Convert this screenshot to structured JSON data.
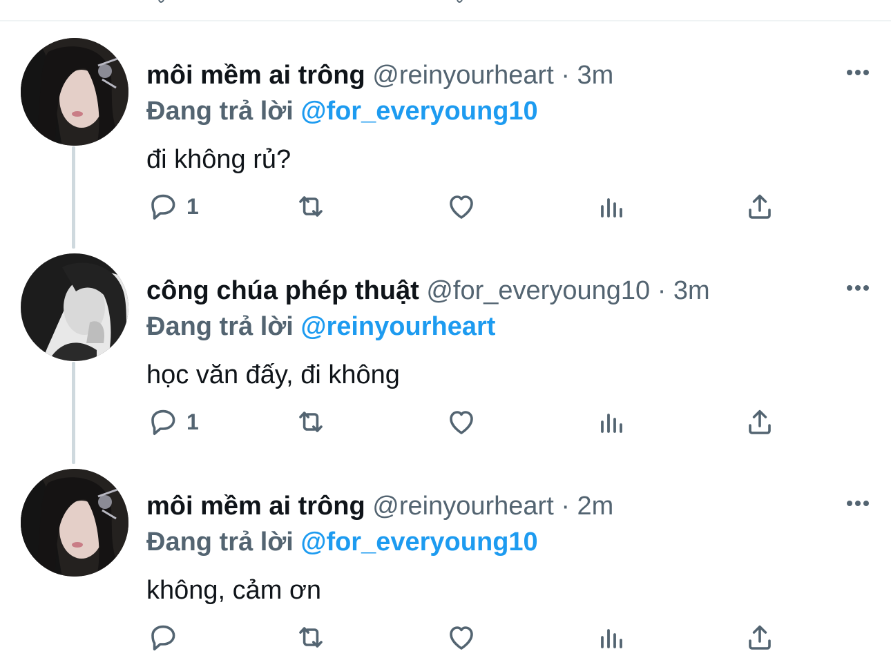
{
  "tweets": [
    {
      "display_name": "môi mềm ai trông",
      "handle": "@reinyourheart",
      "separator": "·",
      "time": "3m",
      "reply_prefix": "Đang trả lời",
      "reply_to": "@for_everyoung10",
      "text": "đi không rủ?",
      "reply_count": "1",
      "avatar": "avatar-photo-dark-hair-ear-cuff"
    },
    {
      "display_name": "công chúa phép thuật",
      "handle": "@for_everyoung10",
      "separator": "·",
      "time": "3m",
      "reply_prefix": "Đang trả lời",
      "reply_to": "@reinyourheart",
      "text": "học văn đấy, đi không",
      "reply_count": "1",
      "avatar": "avatar-photo-monochrome"
    },
    {
      "display_name": "môi mềm ai trông",
      "handle": "@reinyourheart",
      "separator": "·",
      "time": "2m",
      "reply_prefix": "Đang trả lời",
      "reply_to": "@for_everyoung10",
      "text": "không, cảm ơn",
      "reply_count": "",
      "avatar": "avatar-photo-dark-hair-ear-cuff"
    }
  ],
  "icons": {
    "reply": "reply-icon",
    "retweet": "retweet-icon",
    "like": "like-icon",
    "views": "views-icon",
    "share": "share-icon",
    "more": "more-icon"
  },
  "colors": {
    "text_primary": "#0f1419",
    "text_secondary": "#536471",
    "link": "#1d9bf0",
    "thread_line": "#cfd9de"
  }
}
